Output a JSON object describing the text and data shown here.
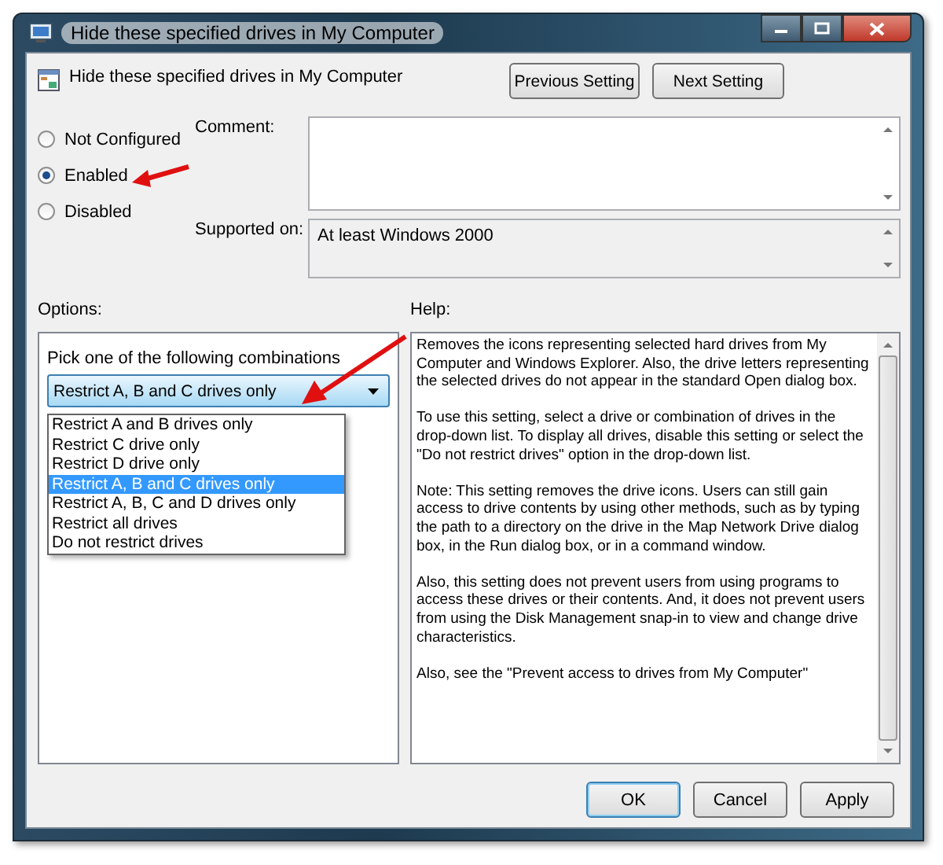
{
  "window": {
    "title": "Hide these specified drives in My Computer"
  },
  "header": {
    "title": "Hide these specified drives in My Computer",
    "buttons": [
      {
        "label": "Previous Setting"
      },
      {
        "label": "Next Setting"
      }
    ]
  },
  "state_options": [
    {
      "label": "Not Configured",
      "selected": false
    },
    {
      "label": "Enabled",
      "selected": true
    },
    {
      "label": "Disabled",
      "selected": false
    }
  ],
  "comment": {
    "label": "Comment:"
  },
  "supported_on": {
    "label": "Supported on:",
    "value": "At least Windows 2000"
  },
  "options": {
    "label": "Options:",
    "prompt": "Pick one of the following combinations",
    "dropdown": {
      "value": "Restrict A, B and C drives only",
      "expanded": true,
      "items": [
        {
          "label": "Restrict A and B drives only",
          "selected": false
        },
        {
          "label": "Restrict C drive only",
          "selected": false
        },
        {
          "label": "Restrict D drive only",
          "selected": false
        },
        {
          "label": "Restrict A, B and C drives only",
          "selected": true
        },
        {
          "label": "Restrict A, B, C and D drives only",
          "selected": false
        },
        {
          "label": "Restrict all drives",
          "selected": false
        },
        {
          "label": "Do not restrict drives",
          "selected": false
        }
      ]
    }
  },
  "help": {
    "label": "Help:",
    "paragraphs": [
      "Removes the icons representing selected hard drives from My Computer and Windows Explorer. Also, the drive letters representing the selected drives do not appear in the standard Open dialog box.",
      "To use this setting, select a drive or combination of drives in the drop-down list. To display all drives, disable this setting or select the \"Do not restrict drives\" option in the drop-down list.",
      "Note: This setting removes the drive icons. Users can still gain access to drive contents by using other methods, such as by typing the path to a directory on the drive in the Map Network Drive dialog box, in the Run dialog box, or in a command window.",
      "Also, this setting does not prevent users from using programs to access these drives or their contents. And, it does not prevent users from using the Disk Management snap-in to view and change drive characteristics.",
      "Also, see the \"Prevent access to drives from My Computer\""
    ]
  },
  "buttons": [
    {
      "label": "OK",
      "default": true
    },
    {
      "label": "Cancel",
      "default": false
    },
    {
      "label": "Apply",
      "default": false
    }
  ]
}
